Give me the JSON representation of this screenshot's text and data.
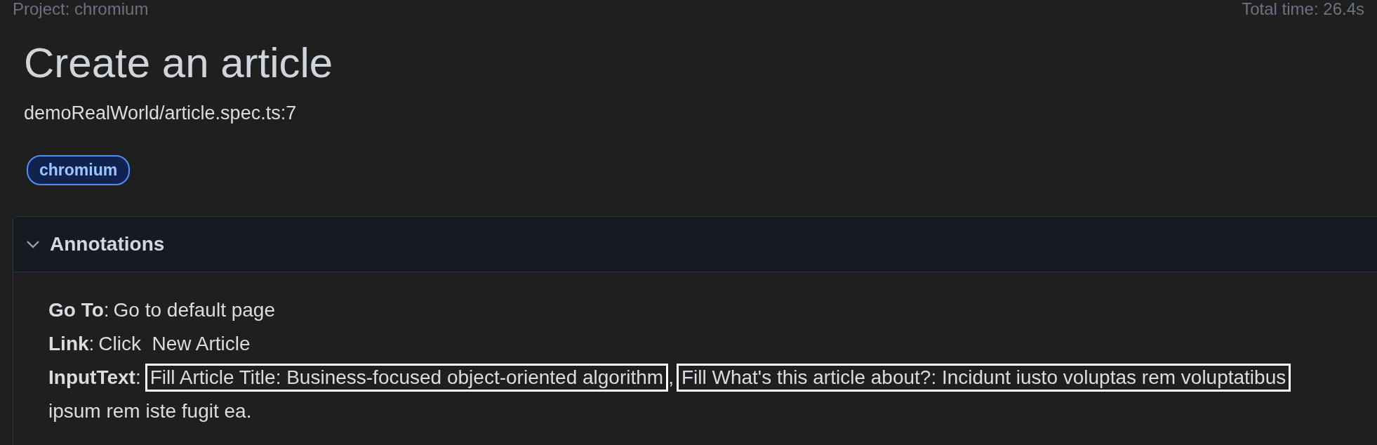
{
  "header": {
    "project": "Project: chromium",
    "total_time": "Total time: 26.4s"
  },
  "test": {
    "title": "Create an article",
    "location": "demoRealWorld/article.spec.ts:7",
    "tags": [
      {
        "label": "chromium",
        "color": "#4f8ff7"
      }
    ]
  },
  "annotations": {
    "title": "Annotations",
    "expanded": true,
    "items": [
      {
        "type": "Go To",
        "separator": ":",
        "parts": [
          {
            "text": "Go to default page",
            "highlighted": false
          }
        ]
      },
      {
        "type": "Link",
        "separator": ":",
        "parts": [
          {
            "text": "Click  New Article",
            "highlighted": false
          }
        ]
      },
      {
        "type": "InputText",
        "separator": ":",
        "parts": [
          {
            "text": "Fill Article Title: Business-focused object-oriented algorithm",
            "highlighted": true
          },
          {
            "text": ",",
            "highlighted": false
          },
          {
            "text": "Fill What's this article about?: Incidunt iusto voluptas rem voluptatibus",
            "highlighted": true
          }
        ],
        "continuation": "ipsum rem iste fugit ea."
      }
    ]
  }
}
